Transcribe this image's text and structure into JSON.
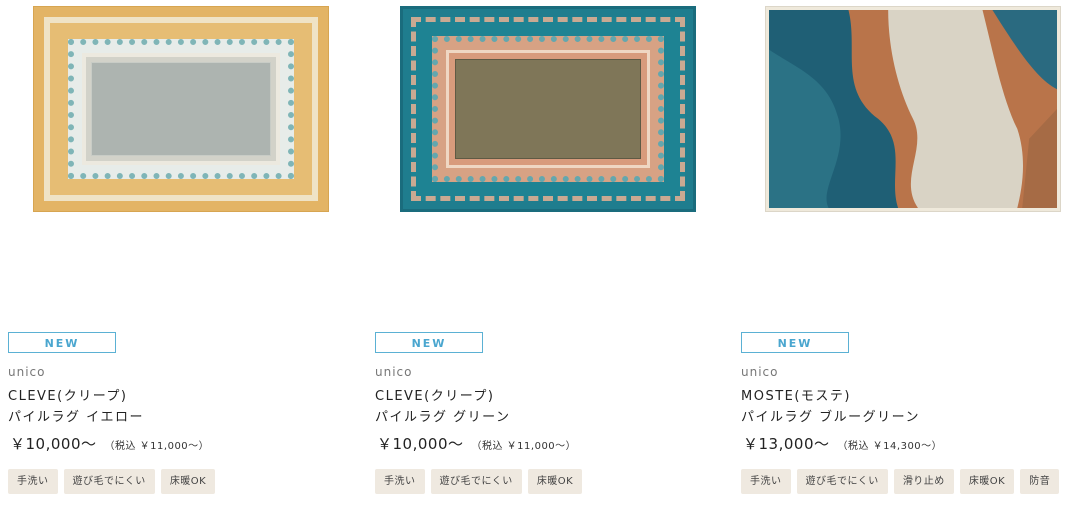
{
  "products": [
    {
      "badge": "NEW",
      "brand": "unico",
      "name_line1": "CLEVE(クリープ)",
      "name_line2": "パイルラグ イエロー",
      "price": "￥10,000～",
      "price_tax": "（税込 ￥11,000～）",
      "image_icon": "rug-yellow-image",
      "tags": [
        "手洗い",
        "遊び毛でにくい",
        "床暖OK"
      ]
    },
    {
      "badge": "NEW",
      "brand": "unico",
      "name_line1": "CLEVE(クリープ)",
      "name_line2": "パイルラグ グリーン",
      "price": "￥10,000～",
      "price_tax": "（税込 ￥11,000～）",
      "image_icon": "rug-teal-image",
      "tags": [
        "手洗い",
        "遊び毛でにくい",
        "床暖OK"
      ]
    },
    {
      "badge": "NEW",
      "brand": "unico",
      "name_line1": "MOSTE(モステ)",
      "name_line2": "パイルラグ ブルーグリーン",
      "price": "￥13,000～",
      "price_tax": "（税込 ￥14,300～）",
      "image_icon": "rug-abstract-image",
      "tags": [
        "手洗い",
        "遊び毛でにくい",
        "滑り止め",
        "床暖OK",
        "防音"
      ]
    }
  ],
  "colors": {
    "badge": "#4aa6cf",
    "tag_bg": "#efe9e0",
    "text": "#222222"
  }
}
